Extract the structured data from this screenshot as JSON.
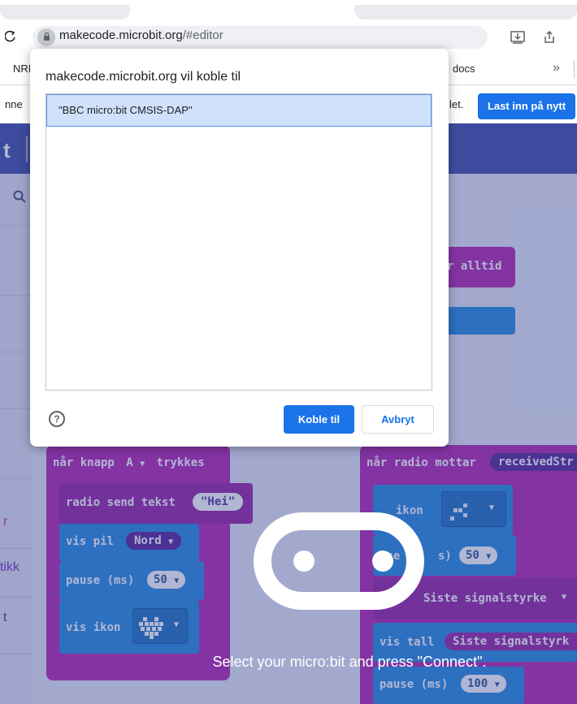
{
  "browser": {
    "url_domain": "makecode.microbit.org",
    "url_path": "/#editor",
    "bookmark_left": "NRI",
    "bookmark_docs": "docs",
    "bookmark_more": "»",
    "infobar_left": "nne",
    "infobar_right": "let.",
    "reload_label": "Last inn på nytt"
  },
  "makecode": {
    "header_letter": "t",
    "toolbox_item_a": "r",
    "toolbox_item_b": "tikk",
    "toolbox_item_c": "t",
    "blocks": {
      "forever_tail": "r alltid",
      "button_hat_prefix": "når knapp",
      "button_value": "A",
      "button_hat_suffix": "trykkes",
      "radio_send": "radio send tekst",
      "radio_send_value": "\"Hei\"",
      "show_arrow": "vis pil",
      "arrow_value": "Nord",
      "pause1": "pause (ms)",
      "pause1_value": "50",
      "show_icon": "vis ikon",
      "radio_recv": "når radio mottar",
      "radio_recv_value": "receivedStr",
      "r_icon": "ikon",
      "r_pause": "use",
      "r_pause_mid": "s)",
      "r_pause_value": "50",
      "signal": "Siste signalstyrke",
      "show_number": "vis tall",
      "show_number_value": "Siste signalstyrk",
      "pause2": "pause (ms)",
      "pause2_value": "100"
    },
    "connect_hint": "Select your micro:bit and press \"Connect\"."
  },
  "dialog": {
    "title": "makecode.microbit.org vil koble til",
    "device": "\"BBC micro:bit CMSIS-DAP\"",
    "help_glyph": "?",
    "connect_label": "Koble til",
    "cancel_label": "Avbryt"
  },
  "icons": {
    "back": "back-icon",
    "lock": "lock-icon",
    "install": "install-icon",
    "share": "share-icon",
    "search": "search-icon",
    "help": "help-icon",
    "dropdown": "▼"
  },
  "colors": {
    "accent": "#1a73e8",
    "makecode_header": "#4353a8",
    "block_blue": "#2b8fe0",
    "block_magenta": "#b52db0"
  }
}
